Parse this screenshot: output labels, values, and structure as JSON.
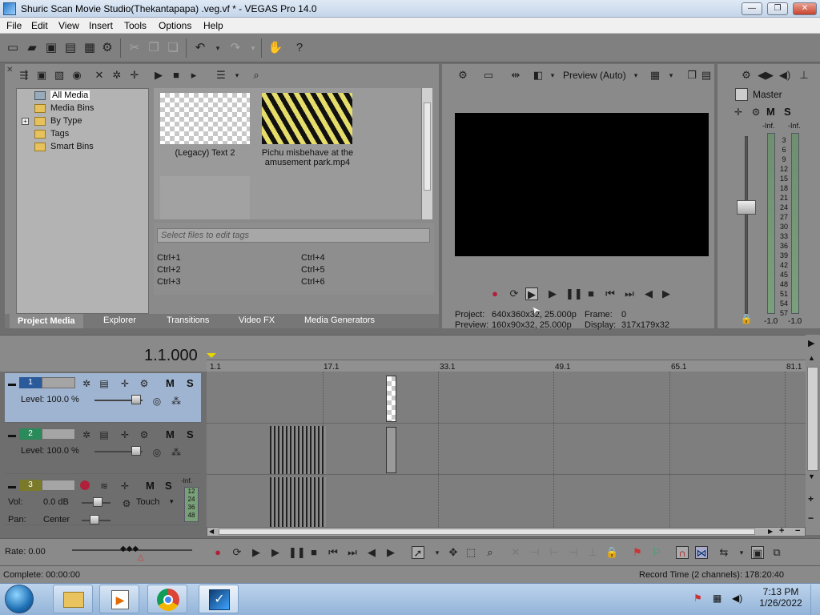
{
  "window": {
    "title": "Shuric Scan Movie Studio(Thekantapapa) .veg.vf * - VEGAS Pro 14.0",
    "minimize": "—",
    "maximize": "❐",
    "close": "✕"
  },
  "menu": [
    "File",
    "Edit",
    "View",
    "Insert",
    "Tools",
    "Options",
    "Help"
  ],
  "media": {
    "tree": [
      "All Media",
      "Media Bins",
      "By Type",
      "Tags",
      "Smart Bins"
    ],
    "thumb1_label": "(Legacy) Text 2",
    "thumb2_label": "Pichu misbehave at the amusement park.mp4",
    "tag_placeholder": "Select files to edit tags",
    "shortcuts": [
      "Ctrl+1",
      "Ctrl+2",
      "Ctrl+3",
      "Ctrl+4",
      "Ctrl+5",
      "Ctrl+6"
    ],
    "tabs": [
      "Project Media",
      "Explorer",
      "Transitions",
      "Video FX",
      "Media Generators"
    ]
  },
  "preview": {
    "mode": "Preview (Auto)",
    "project_label": "Project:",
    "project_value": "640x360x32, 25.000p",
    "preview_label": "Preview:",
    "preview_value": "160x90x32, 25.000p",
    "frame_label": "Frame:",
    "frame_value": "0",
    "display_label": "Display:",
    "display_value": "317x179x32"
  },
  "mixer": {
    "title": "Master",
    "m": "M",
    "s": "S",
    "inf_left": "-Inf.",
    "inf_right": "-Inf.",
    "scale": [
      "3",
      "6",
      "9",
      "12",
      "15",
      "18",
      "21",
      "24",
      "27",
      "30",
      "33",
      "36",
      "39",
      "42",
      "45",
      "48",
      "51",
      "54",
      "57"
    ],
    "bottom_left": "-1.0",
    "bottom_right": "-1.0"
  },
  "timeline": {
    "timecode": "1.1.000",
    "ruler": [
      "1.1",
      "17.1",
      "33.1",
      "49.1",
      "65.1",
      "81.1"
    ],
    "tracks": [
      {
        "num": "1",
        "level_label": "Level: 100.0 %"
      },
      {
        "num": "2",
        "level_label": "Level: 100.0 %"
      },
      {
        "num": "3",
        "vol_label": "Vol:",
        "vol_value": "0.0 dB",
        "pan_label": "Pan:",
        "pan_value": "Center",
        "touch": "Touch",
        "inf": "-Inf.",
        "meter": [
          "12",
          "24",
          "36",
          "48"
        ]
      }
    ],
    "m": "M",
    "s": "S",
    "rate": "Rate: 0.00"
  },
  "status": {
    "complete": "Complete: 00:00:00",
    "record_time": "Record Time (2 channels): 178:20:40"
  },
  "taskbar": {
    "time": "7:13 PM",
    "date": "1/26/2022"
  }
}
